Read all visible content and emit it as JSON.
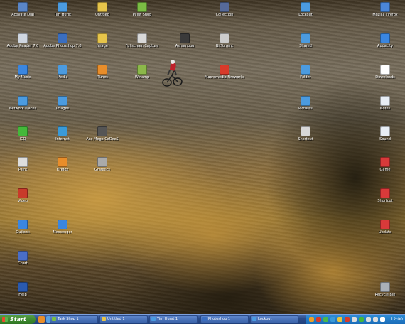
{
  "desktop": {
    "icons": [
      {
        "label": "Activate Dial",
        "icon": "folder-icon",
        "color": "#5a86c8"
      },
      {
        "label": "Tim Hurst",
        "icon": "user-icon",
        "color": "#4b9be0"
      },
      {
        "label": "Untitled",
        "icon": "document-icon",
        "color": "#e6c44a"
      },
      {
        "label": "Paint Shop",
        "icon": "paint-icon",
        "color": "#7bbd44"
      },
      {
        "label": "Collection",
        "icon": "album-icon",
        "color": "#566a9a"
      },
      {
        "label": "Lockout",
        "icon": "folder-icon",
        "color": "#4b9be0"
      },
      {
        "label": "Mozilla Firefox",
        "icon": "firefox-icon",
        "color": "#4b86d8"
      },
      {
        "label": "Adobe Reader 7.0",
        "icon": "adobe-icon",
        "color": "#cfd6e0"
      },
      {
        "label": "Adobe Photoshop 7.0",
        "icon": "photoshop-icon",
        "color": "#3a6ec0"
      },
      {
        "label": "Image",
        "icon": "document-icon",
        "color": "#e6c44a"
      },
      {
        "label": "Fullscreen Capture",
        "icon": "camera-icon",
        "color": "#d8d8d8"
      },
      {
        "label": "Ashampoo",
        "icon": "app-icon",
        "color": "#3a3a3a"
      },
      {
        "label": "BitTorrent",
        "icon": "app-icon",
        "color": "#cccccc"
      },
      {
        "label": "Shared",
        "icon": "folder-icon",
        "color": "#4b9be0"
      },
      {
        "label": "Audacity",
        "icon": "audio-icon",
        "color": "#3a86e0"
      },
      {
        "label": "My Music",
        "icon": "music-icon",
        "color": "#3a86e0"
      },
      {
        "label": "Media",
        "icon": "media-icon",
        "color": "#4b9be0"
      },
      {
        "label": "iTunes",
        "icon": "itunes-icon",
        "color": "#e88d2a"
      },
      {
        "label": "Winamp",
        "icon": "winamp-icon",
        "color": "#8cb84a"
      },
      {
        "label": "Macromedia Fireworks",
        "icon": "fireworks-icon",
        "color": "#d83a2a"
      },
      {
        "label": "Folder",
        "icon": "folder-icon",
        "color": "#4b9be0"
      },
      {
        "label": "Downloads",
        "icon": "document-icon",
        "color": "#ffffff"
      },
      {
        "label": "Network Places",
        "icon": "network-icon",
        "color": "#4b9be0"
      },
      {
        "label": "Images",
        "icon": "folder-icon",
        "color": "#4b9be0"
      },
      {
        "label": "Pictures",
        "icon": "folder-icon",
        "color": "#4b9be0"
      },
      {
        "label": "Notes",
        "icon": "document-icon",
        "color": "#e8eef5"
      },
      {
        "label": "ICQ",
        "icon": "icq-icon",
        "color": "#44b83a"
      },
      {
        "label": "Internet",
        "icon": "globe-icon",
        "color": "#3a9ad8"
      },
      {
        "label": "Ace Mega CoDecS",
        "icon": "app-icon",
        "color": "#555555"
      },
      {
        "label": "Shortcut",
        "icon": "app-icon",
        "color": "#d8d8d8"
      },
      {
        "label": "Sound",
        "icon": "document-icon",
        "color": "#e8eef5"
      },
      {
        "label": "Paint",
        "icon": "paint-icon",
        "color": "#dddddd"
      },
      {
        "label": "Firefox",
        "icon": "firefox-icon",
        "color": "#e88d2a"
      },
      {
        "label": "Graphics",
        "icon": "app-icon",
        "color": "#aaaaaa"
      },
      {
        "label": "Game",
        "icon": "game-icon",
        "color": "#d83a3a"
      },
      {
        "label": "Video",
        "icon": "video-icon",
        "color": "#c83a2a"
      },
      {
        "label": "Shortcut",
        "icon": "app-icon",
        "color": "#d83a3a"
      },
      {
        "label": "Outlook",
        "icon": "mail-icon",
        "color": "#3a86e0"
      },
      {
        "label": "Messenger",
        "icon": "chat-icon",
        "color": "#3a86e0"
      },
      {
        "label": "Update",
        "icon": "app-icon",
        "color": "#d83a3a"
      },
      {
        "label": "Chart",
        "icon": "chart-icon",
        "color": "#4a6ec8"
      },
      {
        "label": "Help",
        "icon": "help-icon",
        "color": "#2a5ab0"
      },
      {
        "label": "Recycle Bin",
        "icon": "recycle-bin-icon",
        "color": "#aab0b8"
      }
    ]
  },
  "taskbar": {
    "start_label": "Start",
    "quick_launch": [
      {
        "icon": "firefox-icon",
        "color": "#e88d2a"
      },
      {
        "icon": "desktop-icon",
        "color": "#5aa0e0"
      },
      {
        "icon": "explorer-icon",
        "color": "#e6c44a"
      }
    ],
    "tasks": [
      {
        "label": "Task Shop 1",
        "color": "#7bbd44"
      },
      {
        "label": "Untitled 1",
        "color": "#e6c44a"
      },
      {
        "label": "Tim Hurst 1",
        "color": "#4b9be0"
      },
      {
        "label": "Photoshop 1",
        "color": "#3a6ec0"
      },
      {
        "label": "Lockout",
        "color": "#4b9be0"
      }
    ],
    "tray_icons": [
      {
        "icon": "sound-icon",
        "color": "#e8a02a"
      },
      {
        "icon": "security-icon",
        "color": "#d83a2a"
      },
      {
        "icon": "messenger-icon",
        "color": "#4bb84a"
      },
      {
        "icon": "network-icon",
        "color": "#3a9ad8"
      },
      {
        "icon": "update-icon",
        "color": "#e8c43a"
      },
      {
        "icon": "antivirus-icon",
        "color": "#d83a2a"
      },
      {
        "icon": "volume-icon",
        "color": "#dddddd"
      },
      {
        "icon": "power-icon",
        "color": "#44b83a"
      },
      {
        "icon": "display-icon",
        "color": "#dddddd"
      },
      {
        "icon": "usb-icon",
        "color": "#dddddd"
      },
      {
        "icon": "chat-icon",
        "color": "#ffffff"
      }
    ],
    "clock": "12:00"
  }
}
